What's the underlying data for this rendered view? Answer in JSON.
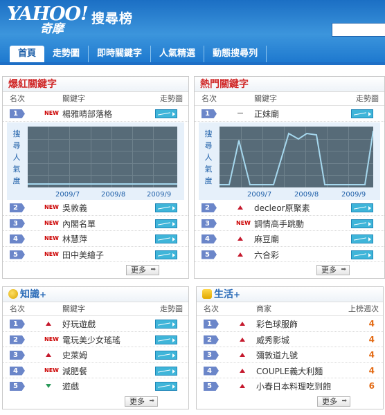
{
  "brand": {
    "logo": "YAHOO!",
    "logo_sub": "奇摩",
    "title": "搜尋榜"
  },
  "tabs": [
    "首頁",
    "走勢圖",
    "即時關鍵字",
    "人氣精選",
    "動態搜尋列"
  ],
  "cols": {
    "rank": "名次",
    "keyword": "關鍵字",
    "trend": "走勢圖",
    "shop": "商家",
    "weeks": "上榜週次"
  },
  "more": "更多",
  "chart": {
    "ylabel": "搜尋人氣度",
    "x": [
      "2009/7",
      "2009/8",
      "2009/9"
    ]
  },
  "panels": {
    "hot": {
      "title": "爆紅關鍵字",
      "rows": [
        {
          "rank": "1",
          "mark": "NEW",
          "keyword": "楊雅晴部落格"
        },
        {
          "rank": "2",
          "mark": "NEW",
          "keyword": "吳敦義"
        },
        {
          "rank": "3",
          "mark": "NEW",
          "keyword": "內閣名單"
        },
        {
          "rank": "4",
          "mark": "NEW",
          "keyword": "林慧萍"
        },
        {
          "rank": "5",
          "mark": "NEW",
          "keyword": "田中美繪子"
        }
      ]
    },
    "popular": {
      "title": "熱門關鍵字",
      "rows": [
        {
          "rank": "1",
          "mark": "—",
          "keyword": "正妹廟"
        },
        {
          "rank": "2",
          "mark": "up",
          "keyword": "decleor原聚素"
        },
        {
          "rank": "3",
          "mark": "NEW",
          "keyword": "調情高手跳動"
        },
        {
          "rank": "4",
          "mark": "up",
          "keyword": "麻豆廟"
        },
        {
          "rank": "5",
          "mark": "up",
          "keyword": "六合彩"
        }
      ]
    },
    "knowledge": {
      "title": "知識",
      "plus": "+",
      "rows": [
        {
          "rank": "1",
          "mark": "up",
          "keyword": "好玩遊戲"
        },
        {
          "rank": "2",
          "mark": "NEW",
          "keyword": "電玩美少女瑤瑤"
        },
        {
          "rank": "3",
          "mark": "up",
          "keyword": "史萊姆"
        },
        {
          "rank": "4",
          "mark": "NEW",
          "keyword": "減肥餐"
        },
        {
          "rank": "5",
          "mark": "down",
          "keyword": "遊戲"
        }
      ]
    },
    "life": {
      "title": "生活",
      "plus": "+",
      "rows": [
        {
          "rank": "1",
          "mark": "up",
          "keyword": "彩色球服飾",
          "weeks": "4"
        },
        {
          "rank": "2",
          "mark": "up",
          "keyword": "威秀影城",
          "weeks": "4"
        },
        {
          "rank": "3",
          "mark": "up",
          "keyword": "彌敦道九號",
          "weeks": "4"
        },
        {
          "rank": "4",
          "mark": "up",
          "keyword": "COUPLE義大利麵",
          "weeks": "4"
        },
        {
          "rank": "5",
          "mark": "up",
          "keyword": "小春日本料理吃到飽",
          "weeks": "6"
        }
      ]
    }
  },
  "colors": {
    "header": "#1e79cf",
    "rank_badge": "#6b86c9",
    "hot_title": "#d02a2a",
    "section_title": "#2a6bb8",
    "weeks": "#e36b15"
  }
}
